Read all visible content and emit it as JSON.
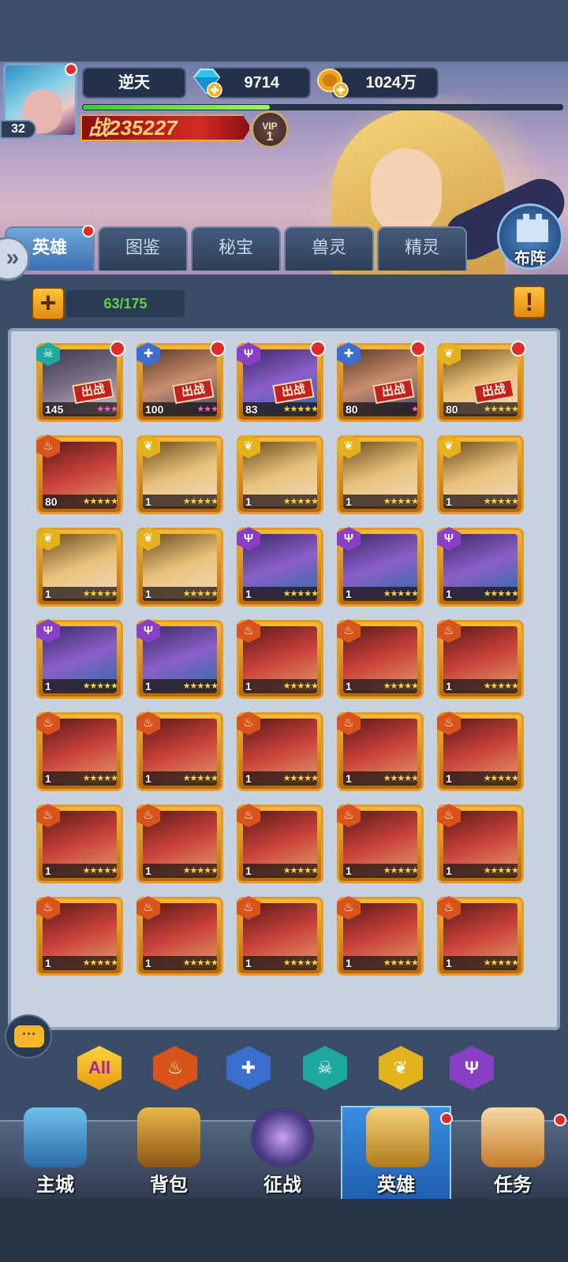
{
  "player": {
    "name": "逆天",
    "level": "32",
    "diamonds": "9714",
    "gold": "1024万",
    "power": "战235227",
    "vip_label": "VIP",
    "vip_level": "1",
    "xp_progress": 0.39
  },
  "tabs": [
    {
      "label": "英雄",
      "active": true
    },
    {
      "label": "图鉴",
      "active": false
    },
    {
      "label": "秘宝",
      "active": false
    },
    {
      "label": "兽灵",
      "active": false
    },
    {
      "label": "精灵",
      "active": false
    }
  ],
  "formation_label": "布阵",
  "hero_count": "63/175",
  "deploy_stamp": "出战",
  "heroes": [
    {
      "level": "145",
      "faction": "skull",
      "stars": 3,
      "star_color": "pink",
      "deployed": true,
      "red_dot": true
    },
    {
      "level": "100",
      "faction": "cross",
      "stars": 3,
      "star_color": "pink",
      "deployed": true,
      "red_dot": true
    },
    {
      "level": "83",
      "faction": "trident",
      "stars": 5,
      "star_color": "gold",
      "deployed": true,
      "red_dot": true
    },
    {
      "level": "80",
      "faction": "cross",
      "stars": 1,
      "star_color": "pink",
      "deployed": true,
      "red_dot": true
    },
    {
      "level": "80",
      "faction": "wing",
      "stars": 5,
      "star_color": "gold",
      "deployed": true,
      "red_dot": true
    },
    {
      "level": "80",
      "faction": "flame",
      "stars": 5,
      "star_color": "gold"
    },
    {
      "level": "1",
      "faction": "wing",
      "stars": 5,
      "star_color": "gold"
    },
    {
      "level": "1",
      "faction": "wing",
      "stars": 5,
      "star_color": "gold"
    },
    {
      "level": "1",
      "faction": "wing",
      "stars": 5,
      "star_color": "gold"
    },
    {
      "level": "1",
      "faction": "wing",
      "stars": 5,
      "star_color": "gold"
    },
    {
      "level": "1",
      "faction": "wing",
      "stars": 5,
      "star_color": "gold"
    },
    {
      "level": "1",
      "faction": "wing",
      "stars": 5,
      "star_color": "gold"
    },
    {
      "level": "1",
      "faction": "trident",
      "stars": 5,
      "star_color": "gold"
    },
    {
      "level": "1",
      "faction": "trident",
      "stars": 5,
      "star_color": "gold"
    },
    {
      "level": "1",
      "faction": "trident",
      "stars": 5,
      "star_color": "gold"
    },
    {
      "level": "1",
      "faction": "trident",
      "stars": 5,
      "star_color": "gold"
    },
    {
      "level": "1",
      "faction": "trident",
      "stars": 5,
      "star_color": "gold"
    },
    {
      "level": "1",
      "faction": "flame",
      "stars": 5,
      "star_color": "gold"
    },
    {
      "level": "1",
      "faction": "flame",
      "stars": 5,
      "star_color": "gold"
    },
    {
      "level": "1",
      "faction": "flame",
      "stars": 5,
      "star_color": "gold"
    },
    {
      "level": "1",
      "faction": "flame",
      "stars": 5,
      "star_color": "gold"
    },
    {
      "level": "1",
      "faction": "flame",
      "stars": 5,
      "star_color": "gold"
    },
    {
      "level": "1",
      "faction": "flame",
      "stars": 5,
      "star_color": "gold"
    },
    {
      "level": "1",
      "faction": "flame",
      "stars": 5,
      "star_color": "gold"
    },
    {
      "level": "1",
      "faction": "flame",
      "stars": 5,
      "star_color": "gold"
    },
    {
      "level": "1",
      "faction": "flame",
      "stars": 5,
      "star_color": "gold"
    },
    {
      "level": "1",
      "faction": "flame",
      "stars": 5,
      "star_color": "gold"
    },
    {
      "level": "1",
      "faction": "flame",
      "stars": 5,
      "star_color": "gold"
    },
    {
      "level": "1",
      "faction": "flame",
      "stars": 5,
      "star_color": "gold"
    },
    {
      "level": "1",
      "faction": "flame",
      "stars": 5,
      "star_color": "gold"
    },
    {
      "level": "1",
      "faction": "flame",
      "stars": 5,
      "star_color": "gold"
    },
    {
      "level": "1",
      "faction": "flame",
      "stars": 5,
      "star_color": "gold"
    },
    {
      "level": "1",
      "faction": "flame",
      "stars": 5,
      "star_color": "gold"
    },
    {
      "level": "1",
      "faction": "flame",
      "stars": 5,
      "star_color": "gold"
    },
    {
      "level": "1",
      "faction": "flame",
      "stars": 5,
      "star_color": "gold"
    }
  ],
  "filters": [
    {
      "label": "All",
      "icon": "all-icon"
    },
    {
      "label": "",
      "icon": "flame-icon"
    },
    {
      "label": "",
      "icon": "cross-icon"
    },
    {
      "label": "",
      "icon": "skull-icon"
    },
    {
      "label": "",
      "icon": "wing-icon"
    },
    {
      "label": "",
      "icon": "trident-icon"
    }
  ],
  "nav": [
    {
      "label": "主城",
      "active": false
    },
    {
      "label": "背包",
      "active": false
    },
    {
      "label": "征战",
      "active": false
    },
    {
      "label": "英雄",
      "active": true
    },
    {
      "label": "任务",
      "active": false
    }
  ]
}
